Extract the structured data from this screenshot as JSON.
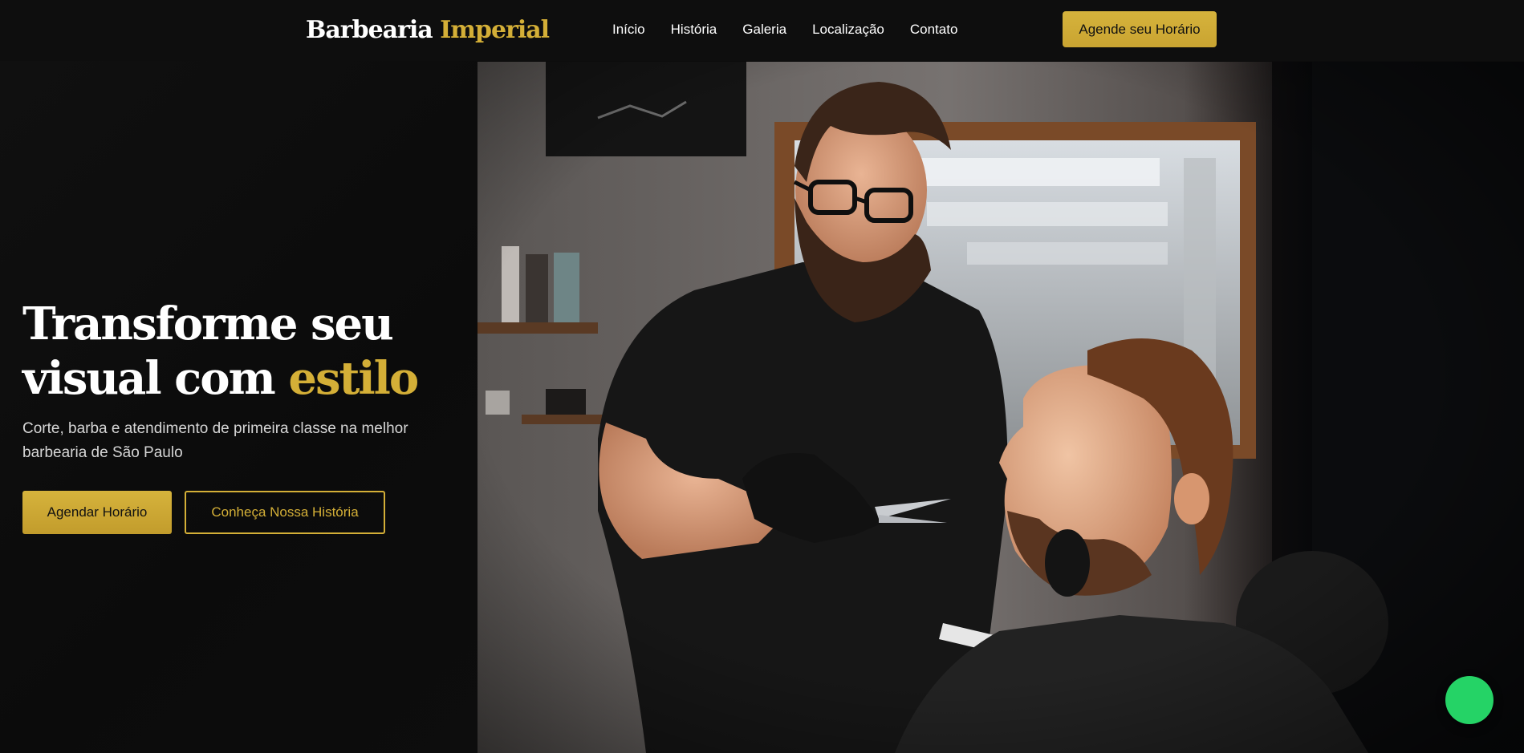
{
  "brand": {
    "name_primary": "Barbearia",
    "name_accent": "Imperial"
  },
  "nav": {
    "links": [
      {
        "label": "Início"
      },
      {
        "label": "História"
      },
      {
        "label": "Galeria"
      },
      {
        "label": "Localização"
      },
      {
        "label": "Contato"
      }
    ],
    "cta_label": "Agende seu Horário"
  },
  "hero": {
    "title_line1": "Transforme seu",
    "title_line2_prefix": "visual com",
    "title_accent": "estilo",
    "subtitle": "Corte, barba e atendimento de primeira classe na melhor barbearia de São Paulo",
    "primary_button": "Agendar Horário",
    "secondary_button": "Conheça Nossa História"
  },
  "floating_button": {
    "icon": "whatsapp-icon"
  },
  "colors": {
    "accent": "#d4af37",
    "background": "#0c0c0c",
    "whatsapp": "#25d366"
  }
}
